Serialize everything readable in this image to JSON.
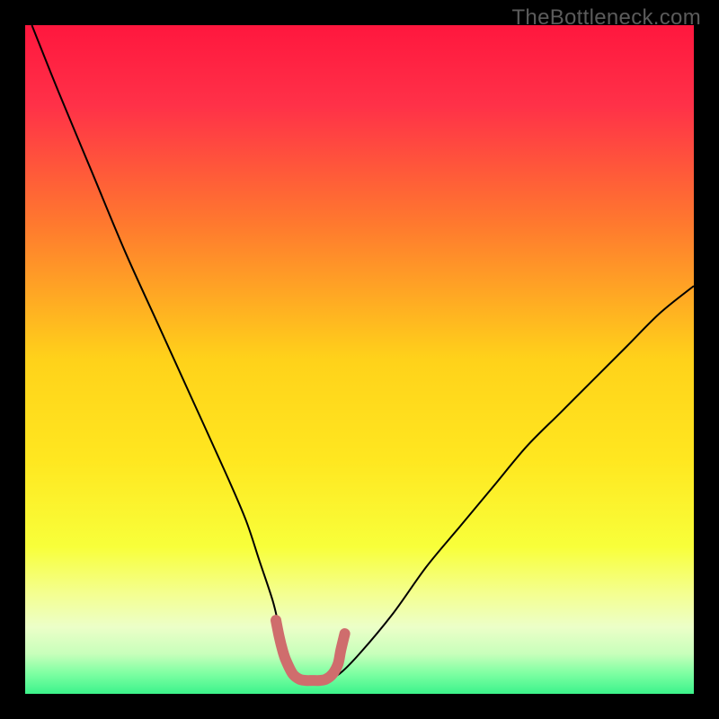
{
  "watermark": "TheBottleneck.com",
  "chart_data": {
    "type": "line",
    "title": "",
    "xlabel": "",
    "ylabel": "",
    "xlim": [
      0,
      100
    ],
    "ylim": [
      0,
      100
    ],
    "background_gradient_stops": [
      {
        "offset": 0.0,
        "color": "#ff173e"
      },
      {
        "offset": 0.12,
        "color": "#ff3148"
      },
      {
        "offset": 0.3,
        "color": "#ff7a2e"
      },
      {
        "offset": 0.5,
        "color": "#ffd21a"
      },
      {
        "offset": 0.65,
        "color": "#ffe720"
      },
      {
        "offset": 0.78,
        "color": "#f8ff3a"
      },
      {
        "offset": 0.85,
        "color": "#f4ff90"
      },
      {
        "offset": 0.9,
        "color": "#ecffc8"
      },
      {
        "offset": 0.94,
        "color": "#c8ffbb"
      },
      {
        "offset": 0.97,
        "color": "#7dffa2"
      },
      {
        "offset": 1.0,
        "color": "#3cf38b"
      }
    ],
    "series": [
      {
        "name": "bottleneck-curve",
        "stroke": "#000000",
        "stroke_width": 2,
        "x": [
          1,
          5,
          10,
          15,
          20,
          25,
          30,
          33,
          35,
          37,
          38,
          39,
          40,
          41,
          42,
          43,
          44,
          45,
          47,
          50,
          55,
          60,
          65,
          70,
          75,
          80,
          85,
          90,
          95,
          100
        ],
        "y": [
          100,
          90,
          78,
          66,
          55,
          44,
          33,
          26,
          20,
          14,
          10,
          7,
          4,
          2.5,
          2,
          2,
          2,
          2.2,
          3,
          6,
          12,
          19,
          25,
          31,
          37,
          42,
          47,
          52,
          57,
          61
        ]
      },
      {
        "name": "flat-minimum-marker",
        "stroke": "#cf6d6d",
        "stroke_width": 12,
        "linecap": "round",
        "x": [
          37.5,
          38,
          38.5,
          39,
          40,
          41,
          42,
          43,
          44,
          45,
          46,
          46.8,
          47.2,
          47.8
        ],
        "y": [
          11,
          8.5,
          6.5,
          5,
          3,
          2.2,
          2,
          2,
          2,
          2.2,
          3,
          4.5,
          6.5,
          9
        ]
      }
    ],
    "notes": "V-shaped bottleneck curve over rainbow gradient; rose-colored marker traces the flat minimum basin around x≈40-47 at y≈2."
  }
}
